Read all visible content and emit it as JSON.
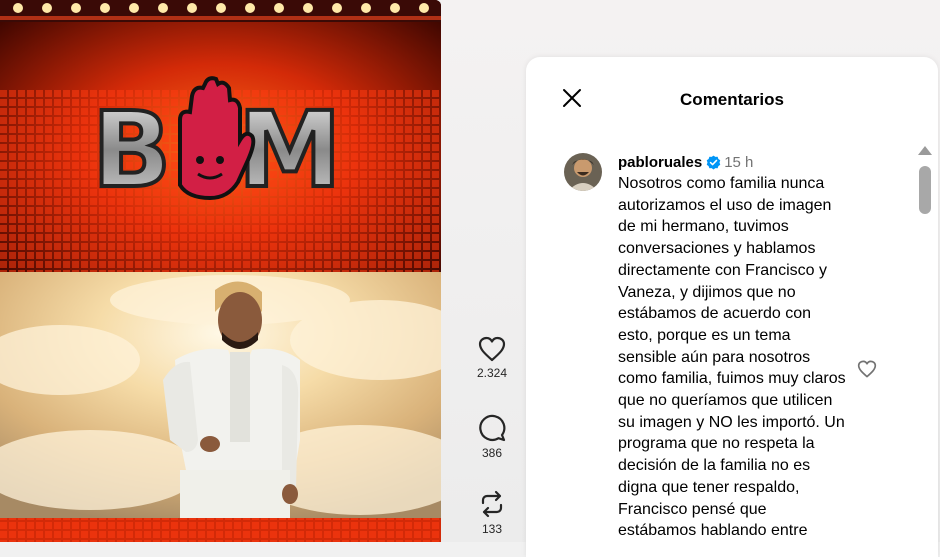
{
  "video": {
    "logo_text": "BOM"
  },
  "actions": {
    "likes": "2.324",
    "comments": "386",
    "reposts": "133"
  },
  "panel": {
    "title": "Comentarios",
    "comment": {
      "username": "pabloruales",
      "time": "15 h",
      "text": "Nosotros como familia nunca autorizamos el uso de imagen de mi hermano, tuvimos conversaciones y hablamos directamente con Francisco y Vaneza, y dijimos que no estábamos de acuerdo con esto, porque es un tema sensible aún para nosotros como familia, fuimos muy claros que no queríamos que utilicen su imagen y NO les importó. Un programa que no respeta la decisión de la familia no es digna que tener respaldo, Francisco pensé que estábamos hablando entre"
    }
  },
  "colors": {
    "verified": "#0095f6",
    "logo_red": "#d21f45",
    "text": "#000000",
    "muted": "#737373"
  }
}
